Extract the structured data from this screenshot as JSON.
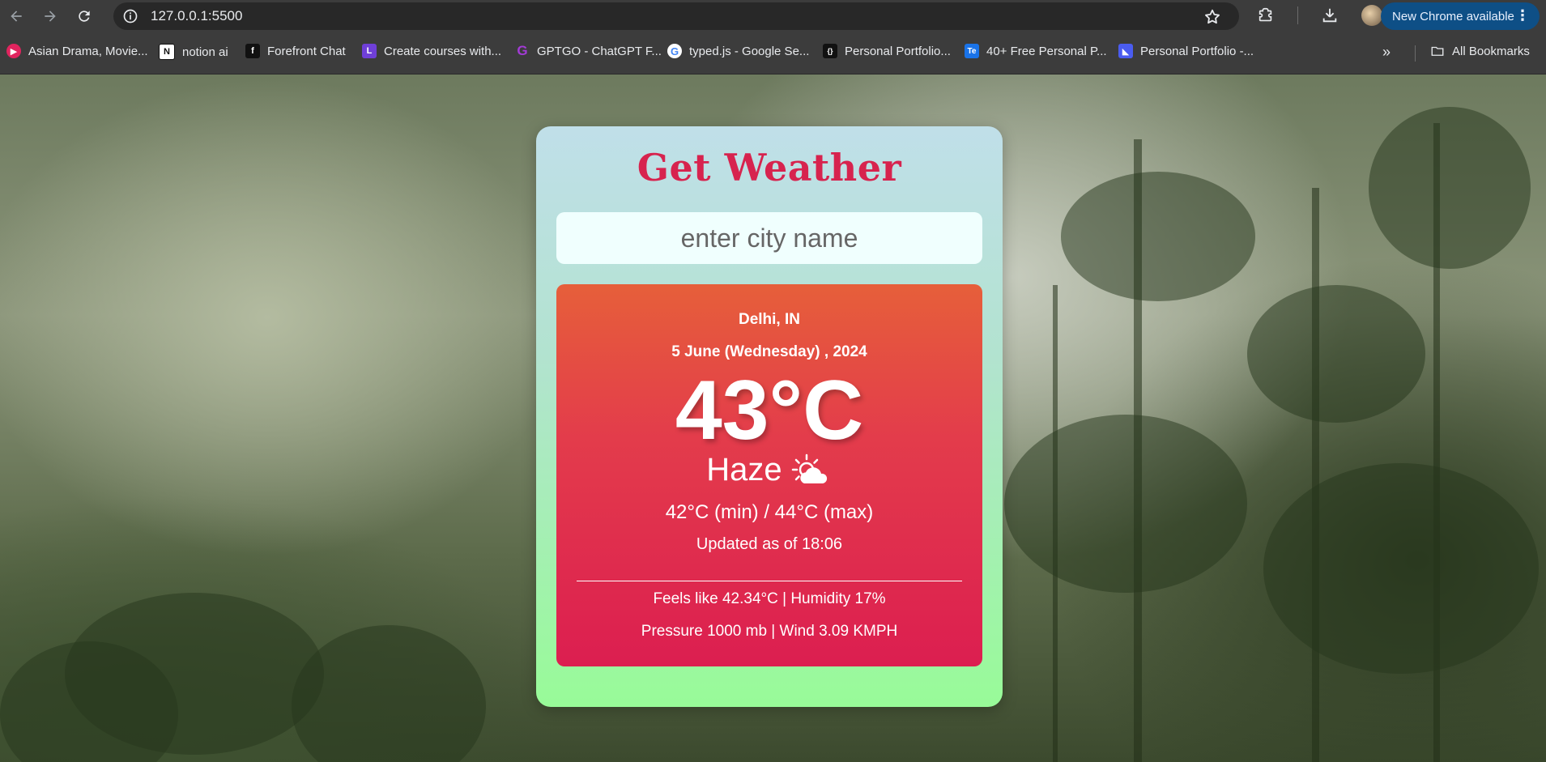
{
  "browser": {
    "url": "127.0.0.1:5500",
    "update_button": "New Chrome available",
    "bookmarks": [
      {
        "label": "Asian Drama, Movie...",
        "icon": "play-icon",
        "color": "#e0245e"
      },
      {
        "label": "notion ai",
        "icon": "notion-icon",
        "color": "#ffffff"
      },
      {
        "label": "Forefront Chat",
        "icon": "forefront-icon",
        "color": "#111111"
      },
      {
        "label": "Create courses with...",
        "icon": "l-icon",
        "color": "#6f3fd8"
      },
      {
        "label": "GPTGO - ChatGPT F...",
        "icon": "g-icon",
        "color": "#a33bd6"
      },
      {
        "label": "typed.js - Google Se...",
        "icon": "google-icon",
        "color": "#ffffff"
      },
      {
        "label": "Personal Portfolio...",
        "icon": "code-icon",
        "color": "#111111"
      },
      {
        "label": "40+ Free Personal P...",
        "icon": "te-icon",
        "color": "#1a73e8"
      },
      {
        "label": "Personal Portfolio -...",
        "icon": "portfolio-icon",
        "color": "#4a5cf0"
      }
    ],
    "all_bookmarks": "All Bookmarks"
  },
  "app": {
    "title": "Get Weather",
    "search_placeholder": "enter city name",
    "city": "Delhi, IN",
    "date": "5 June (Wednesday) , 2024",
    "temperature": "43°C",
    "condition": "Haze",
    "condition_icon": "sun-behind-cloud-icon",
    "minmax": "42°C (min) / 44°C (max)",
    "updated": "Updated as of 18:06",
    "feels_humidity": "Feels like 42.34°C | Humidity 17%",
    "pressure_wind": "Pressure 1000 mb | Wind 3.09 KMPH"
  }
}
